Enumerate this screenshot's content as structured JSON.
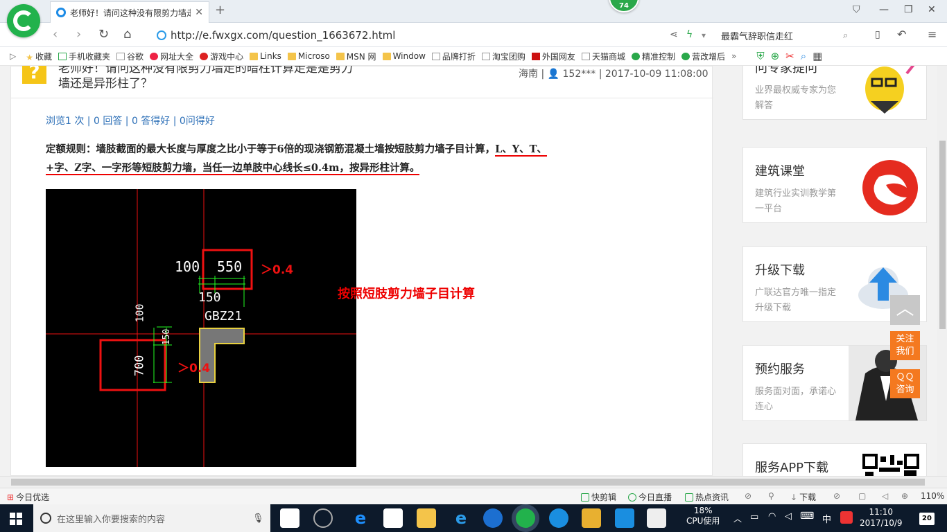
{
  "browser": {
    "tab_title": "老师好！请问这种没有限剪力墙走",
    "badge": "74",
    "url": "http://e.fwxgx.com/question_1663672.html",
    "search_text": "最霸气辞职信走红"
  },
  "bookmarks": [
    "收藏",
    "手机收藏夹",
    "谷歌",
    "网址大全",
    "游戏中心",
    "Links",
    "Microso",
    "MSN 网",
    "Window",
    "品牌打折",
    "淘宝团购",
    "外国网友",
    "天猫商城",
    "精准控制",
    "营改增后"
  ],
  "question": {
    "mark": "?",
    "title_line1": "老师好！请问这种没有限剪力墙走的暗柱计算走是是剪力",
    "title_line2": "墙还是异形柱了？",
    "region": "海南",
    "user": "152***",
    "date": "2017-10-09 11:08:00",
    "stats": "浏览1 次 | 0 回答 | 0 答得好 | 0问得好",
    "rule_part1": "定额规则：墙肢截面的最大长度与厚度之比小于等于6倍的现浇钢筋混凝土墙按短肢剪力墙子目计算，",
    "rule_part2": "L、Y、T、",
    "rule_part3": "+字、Z字、一字形等短肢剪力墙，当任一边单肢中心线长≤0.4m，按异形柱计算。",
    "annotation": "按照短肢剪力墙子目计算"
  },
  "cad": {
    "dim_100_top": "100",
    "dim_550": "550",
    "gt_top": "＞0.4",
    "dim_150": "150",
    "label": "GBZ21",
    "dim_100_left": "100",
    "dim_150_left": "150",
    "dim_700": "700",
    "gt_left": "＞0.4"
  },
  "sidebar": {
    "card0": {
      "title": "问专家提问",
      "desc": "业界最权威专家为您解答"
    },
    "card1": {
      "title": "建筑课堂",
      "desc": "建筑行业实训教学第一平台"
    },
    "card2": {
      "title": "升级下载",
      "desc": "广联达官方唯一指定升级下载"
    },
    "card3": {
      "title": "预约服务",
      "desc": "服务面对面，承诺心连心"
    },
    "card4": {
      "title": "服务APP下载"
    },
    "follow": "关注我们",
    "qq": "ＱＱ咨询"
  },
  "statusbar": {
    "left": "今日优选",
    "items": [
      "快剪辑",
      "今日直播",
      "热点资讯",
      "下载"
    ],
    "zoom": "110%"
  },
  "taskbar": {
    "search_placeholder": "在这里输入你要搜索的内容",
    "cpu": "18%",
    "cpu_label": "CPU使用",
    "ime": "中",
    "time": "11:10",
    "date": "2017/10/9",
    "notifications": "20"
  }
}
